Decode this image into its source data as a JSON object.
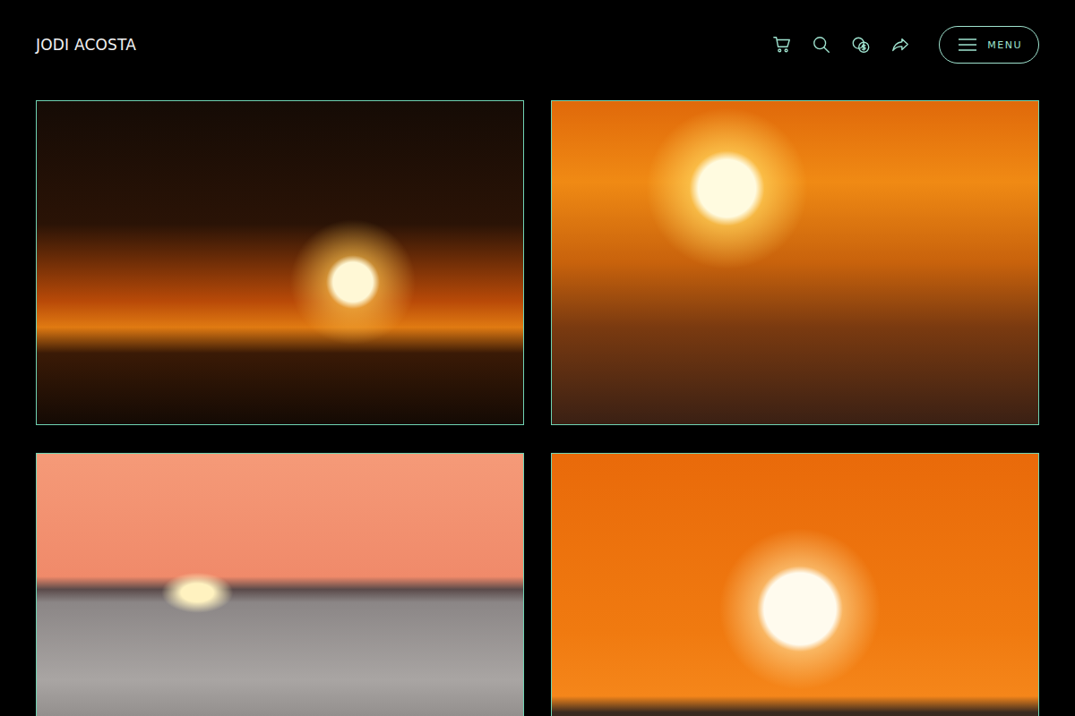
{
  "header": {
    "logo": "JODI ACOSTA",
    "menu_button": {
      "label": "MENU"
    }
  },
  "gallery": {
    "photos": [
      {},
      {},
      {},
      {}
    ]
  }
}
